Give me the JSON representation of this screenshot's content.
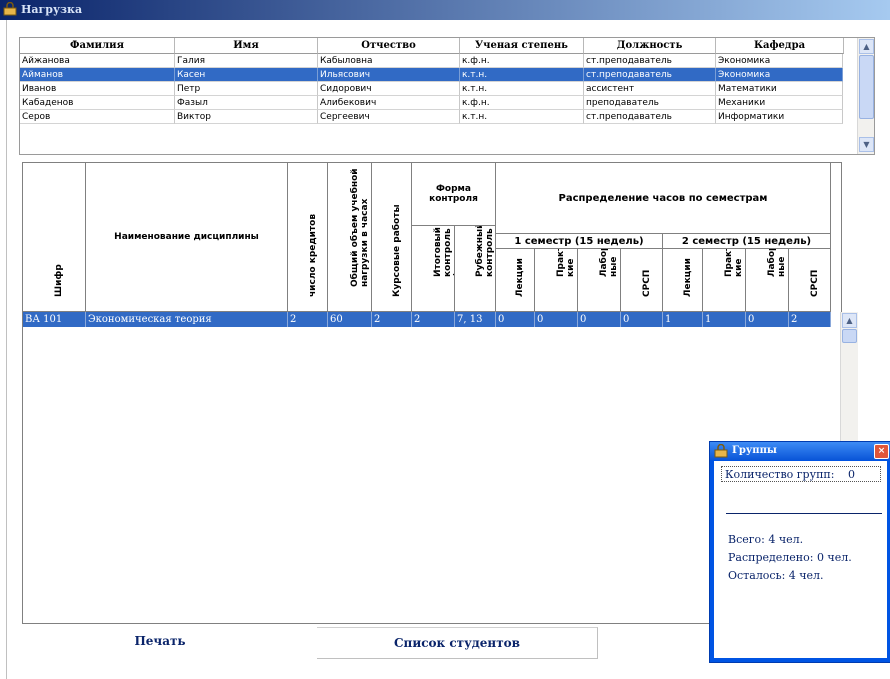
{
  "window": {
    "title": "Нагрузка"
  },
  "top_table": {
    "headers": [
      "Фамилия",
      "Имя",
      "Отчество",
      "Ученая степень",
      "Должность",
      "Кафедра"
    ],
    "rows": [
      [
        "Айжанова",
        "Галия",
        "Кабыловна",
        "к.ф.н.",
        "ст.преподаватель",
        "Экономика"
      ],
      [
        "Айманов",
        "Касен",
        "Ильясович",
        "к.т.н.",
        "ст.преподаватель",
        "Экономика"
      ],
      [
        "Иванов",
        "Петр",
        "Сидорович",
        "к.т.н.",
        "ассистент",
        "Математики"
      ],
      [
        "Кабаденов",
        "Фазыл",
        "Алибекович",
        "к.ф.н.",
        "преподаватель",
        "Механики"
      ],
      [
        "Серов",
        "Виктор",
        "Сергеевич",
        "к.т.н.",
        "ст.преподаватель",
        "Информатики"
      ]
    ],
    "selected_row_index": 1
  },
  "bottom_table": {
    "headers": {
      "code": "Шифр",
      "discipline": "Наименование дисциплины",
      "credits": "число кредитов",
      "total_hours": "Общий объем учебной\nнагрузки в часах",
      "coursework": "Курсовые работы",
      "control_form": "Форма\nконтроля",
      "final_control": "Итоговый\nконтроль\n(семестры)",
      "midterm_control": "Рубежный\nконтроль\n(недели)",
      "distribution": "Распределение часов по семестрам",
      "semester1": "1 семестр (15 недель)",
      "semester2": "2 семестр (15 недель)",
      "lectures": "Лекции",
      "practical": "Практичес\nкие\nзанятия",
      "lab": "Лаборатор\nные\nзанятия",
      "srsp": "СРСП"
    },
    "row": [
      "ВА 101",
      "Экономическая теория",
      "2",
      "60",
      "2",
      "2",
      "7, 13",
      "0",
      "0",
      "0",
      "0",
      "1",
      "1",
      "0",
      "2"
    ]
  },
  "buttons": {
    "print": "Печать",
    "students": "Список студентов"
  },
  "groups_popup": {
    "title": "Группы",
    "group_count_label": "Количество групп:",
    "group_count": "0",
    "total": "Всего: 4 чел.",
    "distributed": "Распределено: 0 чел.",
    "remaining": "Осталось: 4 чел."
  },
  "colors": {
    "selection": "#316ac5",
    "accent_text": "#0a246a"
  }
}
